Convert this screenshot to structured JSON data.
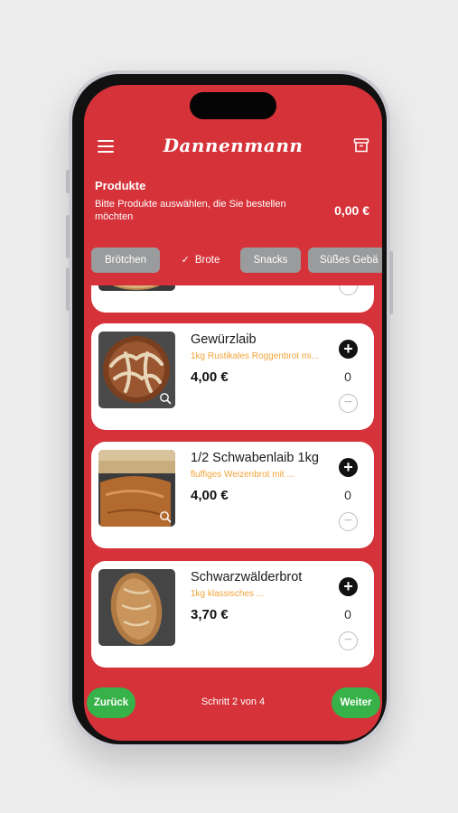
{
  "header": {
    "brand": "Dannenmann"
  },
  "products_section": {
    "title": "Produkte",
    "subtitle": "Bitte Produkte auswählen, die Sie bestellen möchten",
    "total": "0,00 €"
  },
  "tabs": [
    {
      "label": "Brötchen",
      "active": false
    },
    {
      "label": "Brote",
      "active": true
    },
    {
      "label": "Snacks",
      "active": false
    },
    {
      "label": "Süßes Gebä",
      "active": false
    }
  ],
  "products": [
    {
      "name": "Gewürzlaib",
      "description": "1kg Rustikales Roggenbrot mi...",
      "price": "4,00 €",
      "quantity": "0"
    },
    {
      "name": "1/2 Schwabenlaib 1kg",
      "description": "fluffiges Weizenbrot mit ...",
      "price": "4,00 €",
      "quantity": "0"
    },
    {
      "name": "Schwarzwälderbrot",
      "description": "1kg klassisches ...",
      "price": "3,70 €",
      "quantity": "0"
    }
  ],
  "icons": {
    "menu": "menu-icon",
    "archive": "archive-icon",
    "zoom": "zoom-icon",
    "plus": "plus-icon",
    "minus": "minus-icon",
    "check": "check-icon"
  },
  "controls": {
    "plus_symbol": "+",
    "minus_symbol": "−",
    "check_symbol": "✓"
  },
  "footer": {
    "back_label": "Zurück",
    "step_text": "Schritt 2 von 4",
    "next_label": "Weiter"
  },
  "colors": {
    "brand_red": "#d53239",
    "accent_green": "#37b248",
    "tab_gray": "#9a9b9d",
    "desc_orange": "#f2a33a"
  }
}
